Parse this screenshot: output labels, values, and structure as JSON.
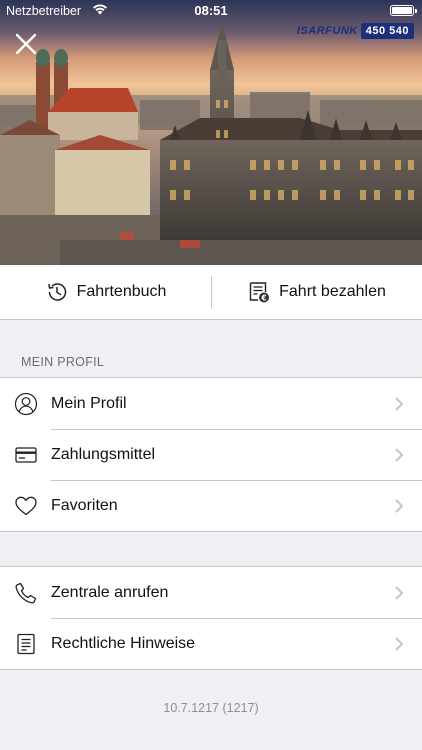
{
  "status_bar": {
    "carrier": "Netzbetreiber",
    "time": "08:51",
    "battery_level": 1.0
  },
  "brand": {
    "name": "ISARFUNK",
    "number": "450 540",
    "color": "#1c2f7a"
  },
  "icons": {
    "close": "close-icon",
    "history": "history-clock-icon",
    "pay": "receipt-euro-icon",
    "profile": "user-icon",
    "payment": "credit-card-icon",
    "favorites": "heart-icon",
    "call": "phone-icon",
    "legal": "document-icon",
    "chevron": "chevron-right-icon"
  },
  "actions": {
    "history_label": "Fahrtenbuch",
    "pay_label": "Fahrt bezahlen"
  },
  "profile_section": {
    "header": "MEIN PROFIL",
    "items": [
      {
        "label": "Mein Profil"
      },
      {
        "label": "Zahlungsmittel"
      },
      {
        "label": "Favoriten"
      }
    ]
  },
  "support_section": {
    "items": [
      {
        "label": "Zentrale anrufen"
      },
      {
        "label": "Rechtliche Hinweise"
      }
    ]
  },
  "version": "10.7.1217 (1217)"
}
